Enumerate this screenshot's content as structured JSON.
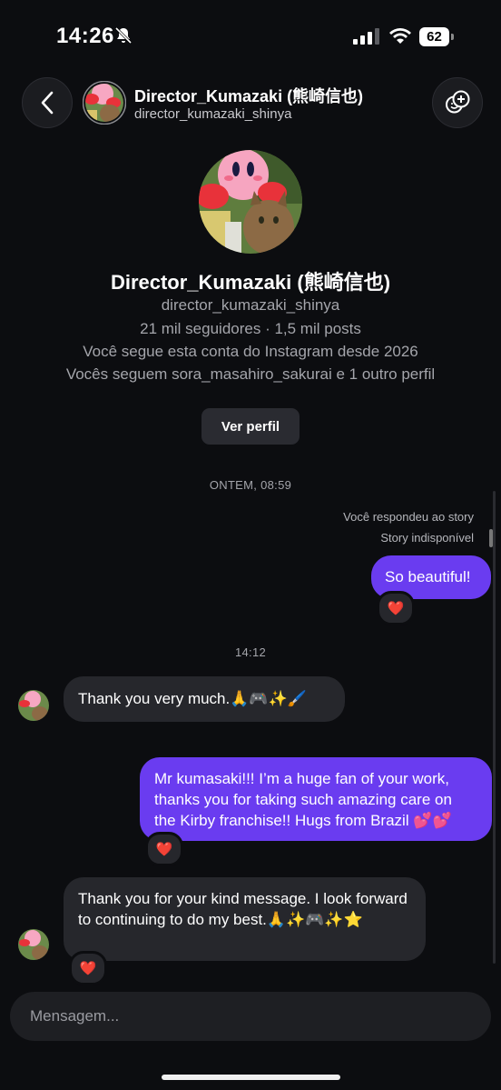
{
  "status_bar": {
    "time": "14:26",
    "battery": "62"
  },
  "header": {
    "name": "Director_Kumazaki (熊崎信也)",
    "username": "director_kumazaki_shinya"
  },
  "profile": {
    "name": "Director_Kumazaki (熊崎信也)",
    "username": "director_kumazaki_shinya",
    "stats": "21 mil seguidores · 1,5 mil posts",
    "following_since": "Você segue esta conta do Instagram desde 2026",
    "mutuals": "Vocês seguem sora_masahiro_sakurai e 1 outro perfil",
    "view_profile": "Ver perfil"
  },
  "chat": {
    "timestamp_1": "ONTEM, 08:59",
    "story_reply_note": "Você respondeu ao story",
    "story_unavailable": "Story indisponível",
    "msg_1": "So beautiful!",
    "timestamp_2": "14:12",
    "msg_2": "Thank you very much.🙏🎮✨🖌️",
    "msg_3": "Mr kumasaki!!! I’m a huge fan of your work, thanks you for taking such amazing care on the Kirby franchise!! Hugs from Brazil 💕💕",
    "msg_4": "Thank you for your kind message. I look forward to continuing to do my best.🙏✨🎮✨⭐",
    "reaction": "❤️"
  },
  "composer": {
    "placeholder": "Mensagem..."
  },
  "colors": {
    "background": "#0c0d10",
    "outgoing": "#6a3cf0",
    "incoming": "#26272c"
  }
}
